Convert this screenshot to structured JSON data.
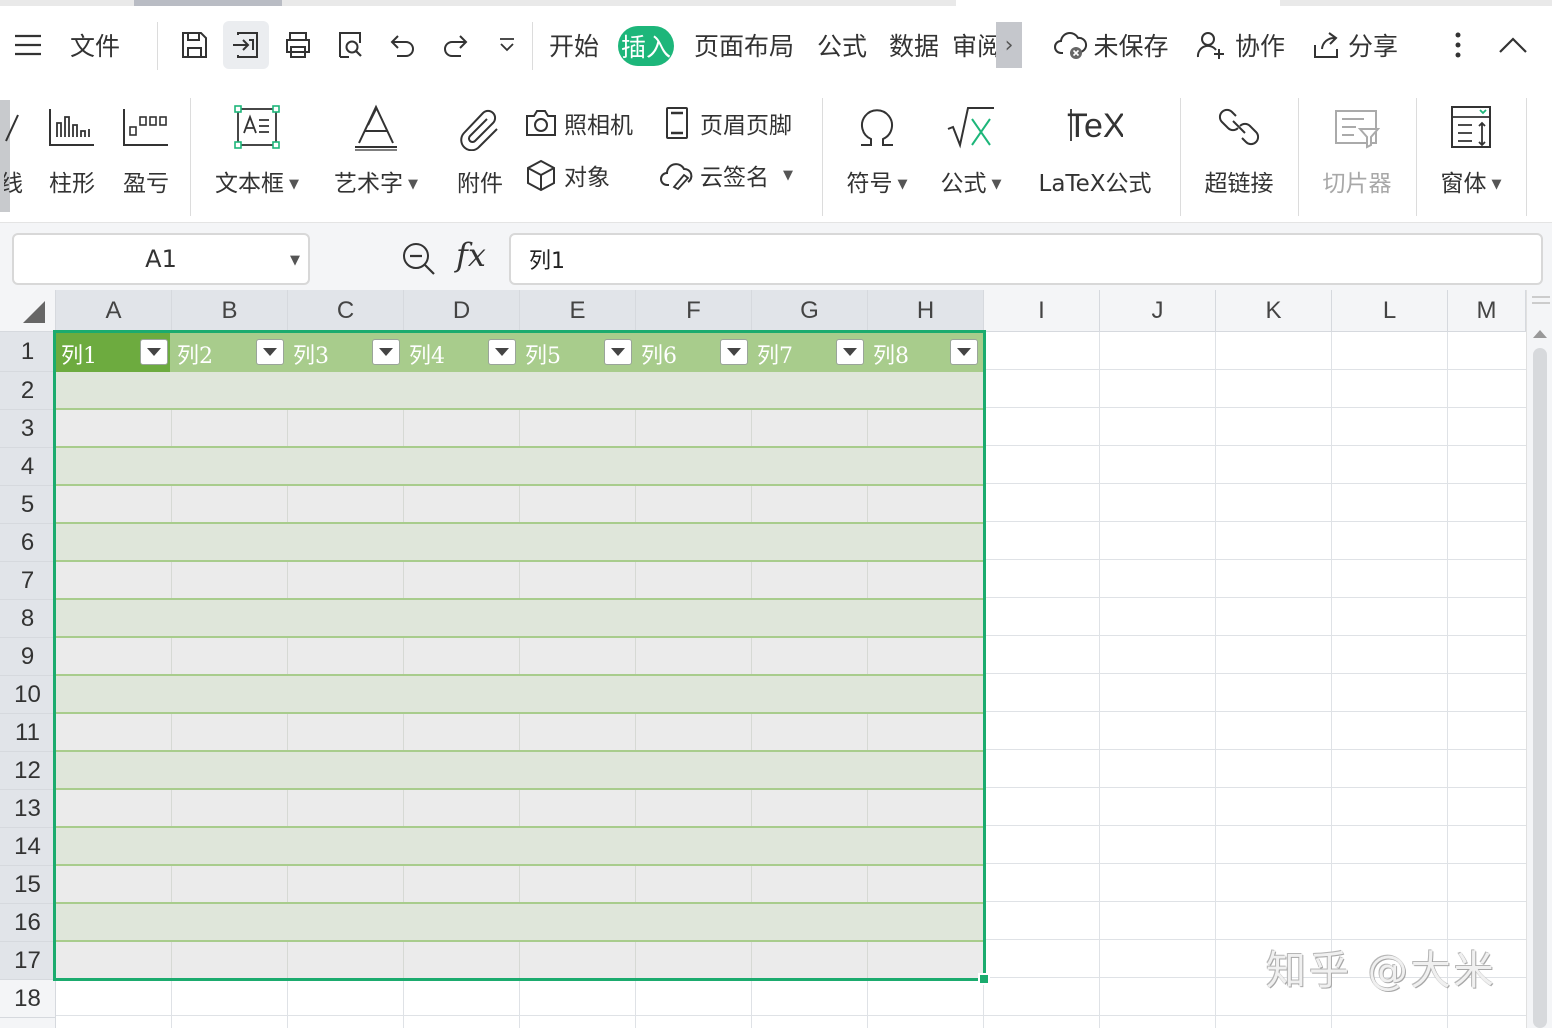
{
  "menubar": {
    "file": "文件",
    "tabs": [
      "开始",
      "插入",
      "页面布局",
      "公式",
      "数据",
      "审阅"
    ],
    "active_tab": "插入",
    "unsaved": "未保存",
    "collab": "协作",
    "share": "分享"
  },
  "ribbon": {
    "line_partial": "线",
    "column": "柱形",
    "winloss": "盈亏",
    "textbox": "文本框",
    "wordart": "艺术字",
    "attachment": "附件",
    "camera": "照相机",
    "object": "对象",
    "header_footer": "页眉页脚",
    "cloud_sign": "云签名",
    "symbol": "符号",
    "formula": "公式",
    "latex": "LaTeX公式",
    "hyperlink": "超链接",
    "slicer": "切片器",
    "form": "窗体"
  },
  "formula_bar": {
    "name_box": "A1",
    "fx": "fx",
    "value": "列1"
  },
  "grid": {
    "columns": [
      "A",
      "B",
      "C",
      "D",
      "E",
      "F",
      "G",
      "H",
      "I",
      "J",
      "K",
      "L",
      "M"
    ],
    "rows": [
      "1",
      "2",
      "3",
      "4",
      "5",
      "6",
      "7",
      "8",
      "9",
      "10",
      "11",
      "12",
      "13",
      "14",
      "15",
      "16",
      "17",
      "18"
    ],
    "table_headers": [
      "列1",
      "列2",
      "列3",
      "列4",
      "列5",
      "列6",
      "列7",
      "列8"
    ]
  },
  "colors": {
    "accent": "#1db67a",
    "header_active": "#6dab3f",
    "header_row": "#a8cc8c",
    "band_dark": "#dfe6da",
    "band_light": "#ebebeb",
    "selection": "#1bab6e"
  },
  "watermark": "知乎 @大米"
}
